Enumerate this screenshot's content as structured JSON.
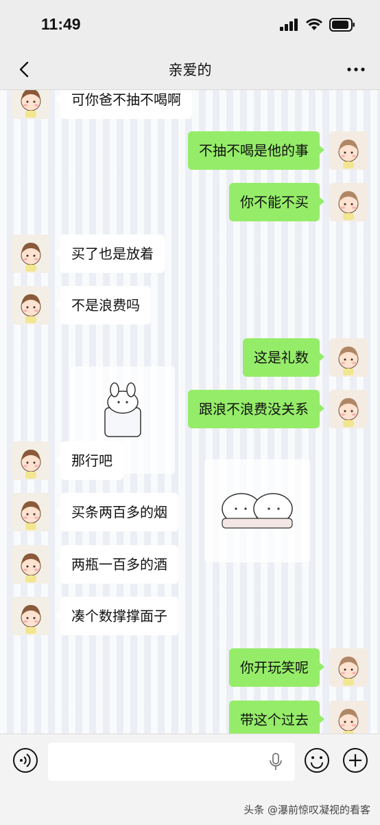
{
  "status": {
    "time": "11:49"
  },
  "header": {
    "title": "亲爱的"
  },
  "messages": [
    {
      "side": "in",
      "text": "可你爸不抽不喝啊"
    },
    {
      "side": "out",
      "text": "不抽不喝是他的事"
    },
    {
      "side": "out",
      "text": "你不能不买"
    },
    {
      "side": "in",
      "text": "买了也是放着"
    },
    {
      "side": "in",
      "text": "不是浪费吗"
    },
    {
      "side": "out",
      "text": "这是礼数"
    },
    {
      "side": "out",
      "text": "跟浪不浪费没关系"
    },
    {
      "side": "in",
      "text": "那行吧"
    },
    {
      "side": "in",
      "text": "买条两百多的烟"
    },
    {
      "side": "in",
      "text": "两瓶一百多的酒"
    },
    {
      "side": "in",
      "text": "凑个数撑撑面子"
    },
    {
      "side": "out",
      "text": "你开玩笑呢"
    },
    {
      "side": "out",
      "text": "带这个过去"
    }
  ],
  "footer": {
    "watermark": "头条 @瀑前惊叹凝视的看客"
  },
  "colors": {
    "out_bubble": "#95ec69",
    "in_bubble": "#ffffff",
    "bar": "#ededed"
  }
}
